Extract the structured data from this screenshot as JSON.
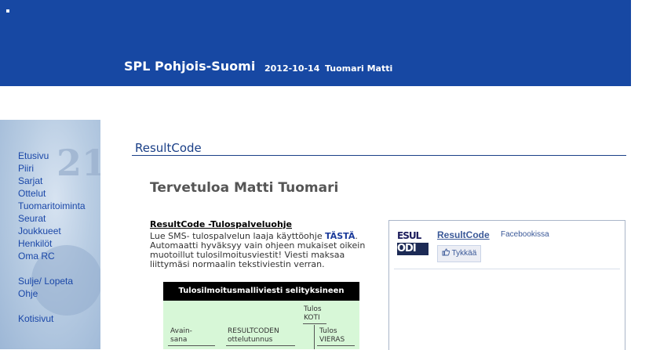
{
  "header": {
    "org": "SPL Pohjois-Suomi",
    "date": "2012-10-14",
    "user": "Tuomari Matti"
  },
  "sidebar": {
    "background_number": "21",
    "items": [
      {
        "label": "Etusivu"
      },
      {
        "label": "Piiri"
      },
      {
        "label": "Sarjat"
      },
      {
        "label": "Ottelut"
      },
      {
        "label": "Tuomaritoiminta"
      },
      {
        "label": "Seurat"
      },
      {
        "label": "Joukkueet"
      },
      {
        "label": "Henkilöt"
      },
      {
        "label": "Oma RC"
      }
    ],
    "secondary": [
      {
        "label": "Sulje/ Lopeta"
      },
      {
        "label": "Ohje"
      }
    ],
    "tertiary": [
      {
        "label": "Kotisivut"
      }
    ]
  },
  "main": {
    "section_title": "ResultCode",
    "welcome": "Tervetuloa Matti Tuomari",
    "help": {
      "title": "ResultCode -Tulospalveluohje",
      "text_before": "Lue SMS- tulospalvelun laaja käyttöohje ",
      "link": "TÄSTÄ",
      "text_after": ". Automaatti hyväksyy vain ohjeen mukaiset oikein muotoillut tulosilmoitusviestit! Viesti maksaa liittymäsi normaalin tekstiviestin verran."
    },
    "table": {
      "title": "Tulosilmoitusmalliviesti selityksineen",
      "col_home": "Tulos KOTI",
      "col_key": "Avain- sana",
      "col_code": "RESULTCODEN ottelutunnus",
      "col_away": "Tulos VIERAS"
    }
  },
  "facebook": {
    "logo_top": "ESUL",
    "logo_bottom": "ODI",
    "name": "ResultCode",
    "subtitle": "Facebookissa",
    "like": "Tykkää"
  },
  "colors": {
    "header_bg": "#1748a3",
    "nav_link": "#1a47a8",
    "table_bg": "#d7f7d7",
    "fb_blue": "#3b5998"
  }
}
